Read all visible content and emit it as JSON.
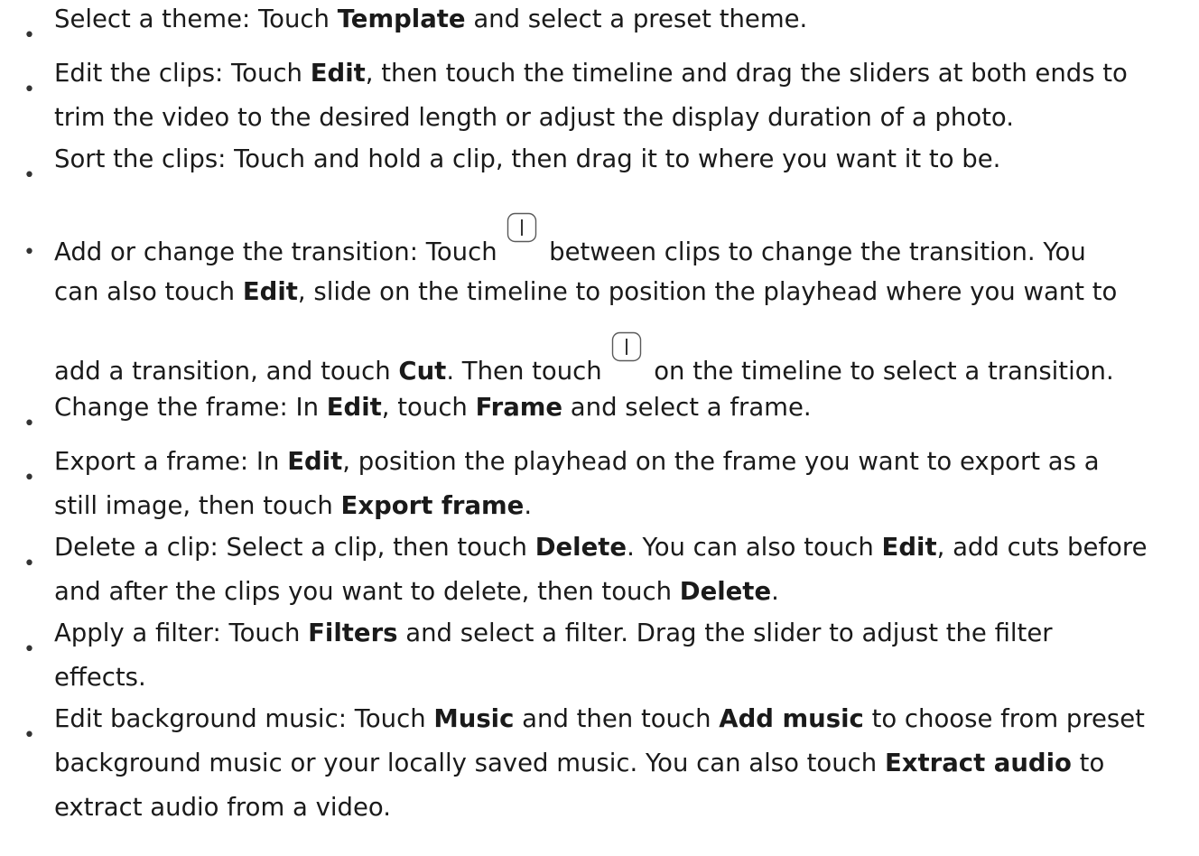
{
  "bullet_char": "•",
  "items": [
    {
      "label": "Select a theme",
      "line1": {
        "t1": "Select a theme: Touch ",
        "b1": "Template",
        "t2": " and select a preset theme."
      }
    },
    {
      "label": "Edit the clips",
      "line1": {
        "t1": "Edit the clips: Touch ",
        "b1": "Edit",
        "t2": ", then touch the timeline and drag the sliders at both ends to"
      },
      "line2": {
        "t1": "trim the video to the desired length or adjust the display duration of a photo."
      }
    },
    {
      "label": "Sort the clips",
      "line1": {
        "t1": "Sort the clips: Touch and hold a clip, then drag it to where you want it to be."
      }
    },
    {
      "label": "Add or change the transition",
      "line1": {
        "t1": "Add or change the transition: Touch ",
        "t2": " between clips to change the transition. You"
      },
      "line2": {
        "t1": "can also touch ",
        "b1": "Edit",
        "t2": ", slide on the timeline to position the playhead where you want to"
      },
      "line3": {
        "t1": "add a transition, and touch ",
        "b1": "Cut",
        "t2": ". Then touch ",
        "t3": " on the timeline to select a transition."
      },
      "icon": "transition-icon"
    },
    {
      "label": "Change the frame",
      "line1": {
        "t1": "Change the frame: In ",
        "b1": "Edit",
        "t2": ", touch ",
        "b2": "Frame",
        "t3": " and select a frame."
      }
    },
    {
      "label": "Export a frame",
      "line1": {
        "t1": "Export a frame: In ",
        "b1": "Edit",
        "t2": ", position the playhead on the frame you want to export as a"
      },
      "line2": {
        "t1": "still image, then touch ",
        "b1": "Export frame",
        "t2": "."
      }
    },
    {
      "label": "Delete a clip",
      "line1": {
        "t1": "Delete a clip: Select a clip, then touch ",
        "b1": "Delete",
        "t2": ". You can also touch ",
        "b2": "Edit",
        "t3": ", add cuts before"
      },
      "line2": {
        "t1": "and after the clips you want to delete, then touch ",
        "b1": "Delete",
        "t2": "."
      }
    },
    {
      "label": "Apply a filter",
      "line1": {
        "t1": "Apply a filter: Touch ",
        "b1": "Filters",
        "t2": " and select a filter. Drag the slider to adjust the filter"
      },
      "line2": {
        "t1": "effects."
      }
    },
    {
      "label": "Edit background music",
      "line1": {
        "t1": "Edit background music: Touch ",
        "b1": "Music",
        "t2": " and then touch ",
        "b2": "Add music",
        "t3": " to choose from preset"
      },
      "line2": {
        "t1": "background music or your locally saved music. You can also touch ",
        "b1": "Extract audio",
        "t2": " to"
      },
      "line3": {
        "t1": "extract audio from a video."
      }
    }
  ]
}
